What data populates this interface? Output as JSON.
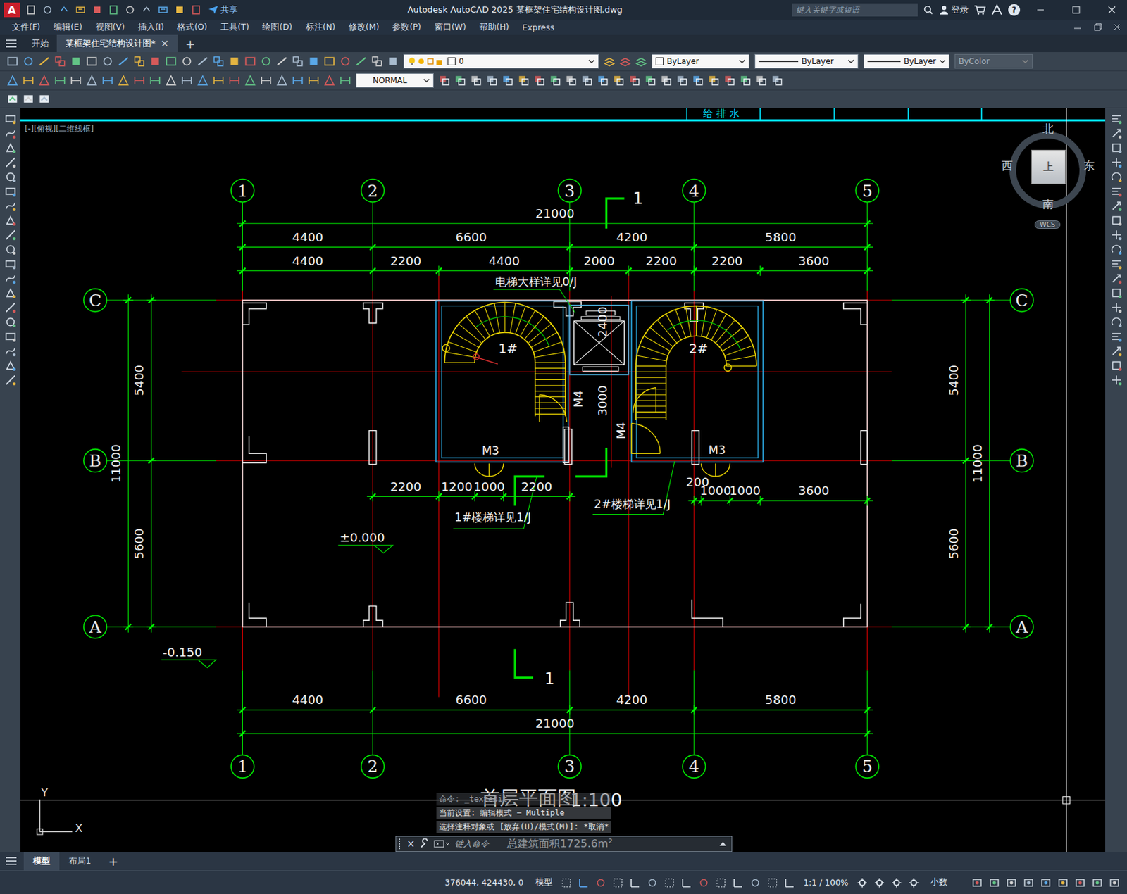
{
  "window": {
    "logo": "A",
    "share": "共享",
    "title": "Autodesk AutoCAD 2025    某框架住宅结构设计图.dwg",
    "search_placeholder": "键入关键字或短语",
    "login": "登录",
    "help": "?"
  },
  "menu": [
    "文件(F)",
    "编辑(E)",
    "视图(V)",
    "插入(I)",
    "格式(O)",
    "工具(T)",
    "绘图(D)",
    "标注(N)",
    "修改(M)",
    "参数(P)",
    "窗口(W)",
    "帮助(H)",
    "Express"
  ],
  "doc_tabs": [
    {
      "label": "开始",
      "selected": false,
      "closable": false
    },
    {
      "label": "某框架住宅结构设计图*",
      "selected": true,
      "closable": true
    }
  ],
  "tab_close": "×",
  "tab_add": "+",
  "properties": {
    "layer": "0",
    "color": "ByLayer",
    "linetype": "ByLayer",
    "lineweight": "ByLayer",
    "plotstyle": "ByColor",
    "plotstyle_disabled": true,
    "text_style": "NORMAL"
  },
  "viewport": {
    "label": "[-][俯视][二维线框]",
    "header": "给 排 水"
  },
  "viewcube": {
    "north": "北",
    "south": "南",
    "east": "东",
    "west": "西",
    "face": "上",
    "ucs": "WCS"
  },
  "ucs_icon": {
    "x": "X",
    "y": "Y"
  },
  "drawing": {
    "axis_columns": [
      "1",
      "2",
      "3",
      "4",
      "5"
    ],
    "axis_rows": [
      "C",
      "B",
      "A"
    ],
    "dims_top": [
      [
        "21000"
      ],
      [
        "4400",
        "6600",
        "4200",
        "5800"
      ],
      [
        "4400",
        "2200",
        "4400",
        "2000",
        "2200",
        "2200",
        "3600"
      ]
    ],
    "dims_bottom": [
      [
        "4400",
        "6600",
        "4200",
        "5800"
      ],
      [
        "21000"
      ]
    ],
    "dims_left": [
      [
        "5400",
        "5600"
      ],
      [
        "11000"
      ]
    ],
    "dims_right": [
      [
        "5400",
        "5600"
      ],
      [
        "11000"
      ]
    ],
    "dims_inner_left": [
      "2200",
      "1200",
      "1000",
      "2200"
    ],
    "dims_inner_right": [
      "200",
      "1000",
      "1000",
      "3600"
    ],
    "annotations": {
      "elevator_note": "电梯大样详见0/J",
      "stair1_label": "1#",
      "stair2_label": "2#",
      "elevator_size": "2400",
      "stair_gap": "3000",
      "door_m4_a": "M4",
      "door_m4_b": "M4",
      "door_m3_a": "M3",
      "door_m3_b": "M3",
      "stair1_note": "1#楼梯详见1/J",
      "stair2_note": "2#楼梯详见1/J",
      "level_ground": "±0.000",
      "level_outside": "-0.150",
      "section_top": "1",
      "section_bottom": "1",
      "title": "首层平面图",
      "scale": "1:100",
      "area": "总建筑面积1725.6m²"
    }
  },
  "command": {
    "history": [
      "命令:  _textedit",
      "当前设置: 编辑模式 = Multiple",
      "选择注释对象或 [放弃(U)/模式(M)]: *取消*"
    ],
    "placeholder": "键入命令",
    "close": "×"
  },
  "layout_tabs": [
    {
      "label": "模型",
      "selected": true
    },
    {
      "label": "布局1",
      "selected": false
    }
  ],
  "layout_add": "+",
  "status_bar": {
    "coords": "376044, 424430, 0",
    "space": "模型",
    "scale": "1:1 / 100%",
    "units": "小数"
  }
}
